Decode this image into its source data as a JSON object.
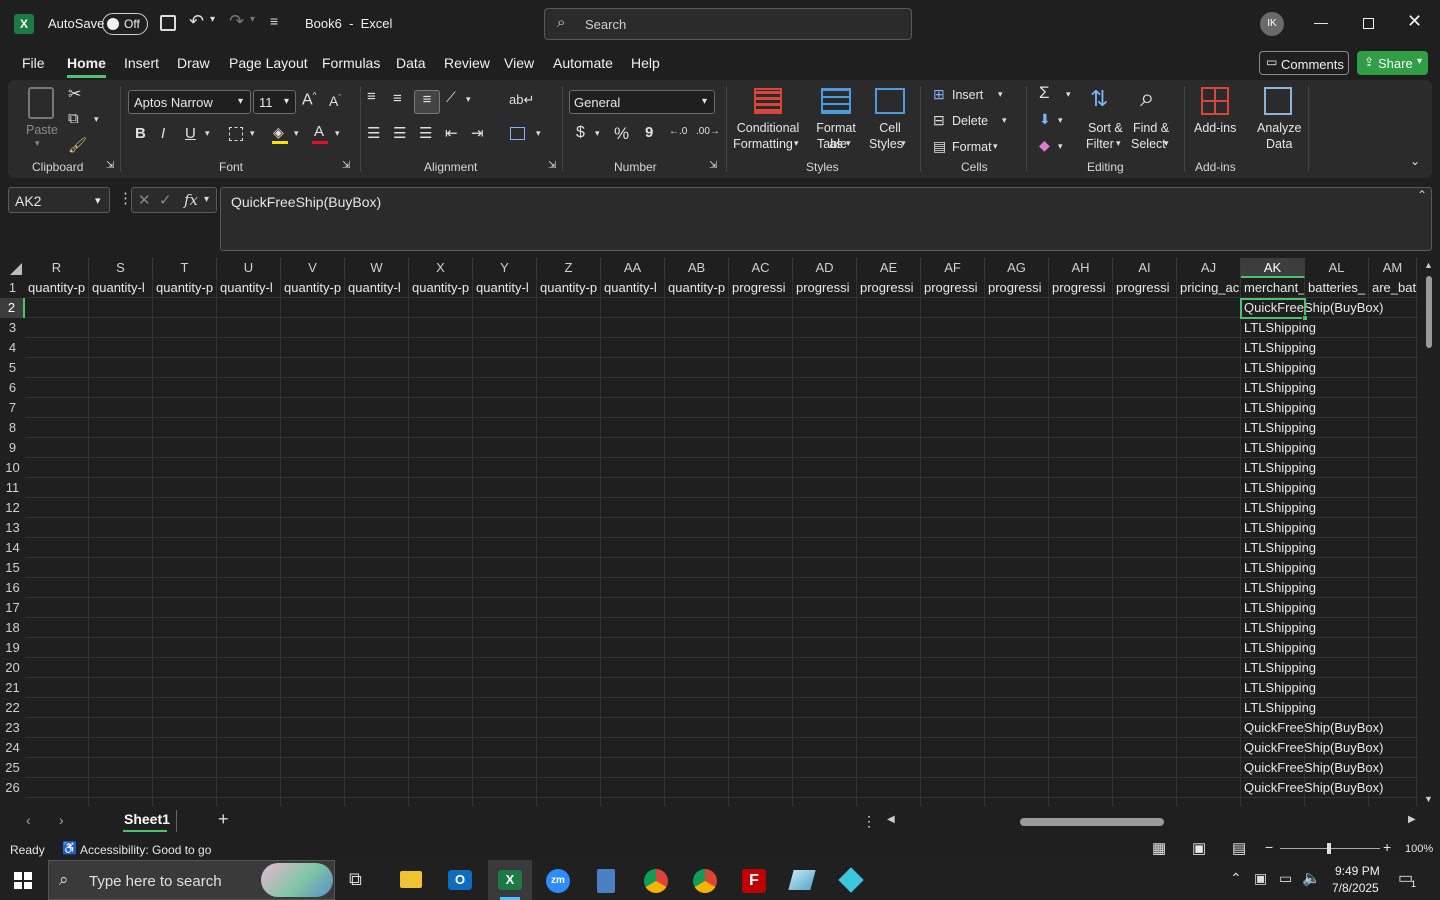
{
  "titlebar": {
    "autosave_label": "AutoSave",
    "autosave_state": "Off",
    "document_title": "Book6  -  Excel",
    "search_placeholder": "Search",
    "avatar_initials": "IK"
  },
  "menu": {
    "items": [
      "File",
      "Home",
      "Insert",
      "Draw",
      "Page Layout",
      "Formulas",
      "Data",
      "Review",
      "View",
      "Automate",
      "Help"
    ],
    "active": "Home",
    "comments_label": "Comments",
    "share_label": "Share"
  },
  "ribbon": {
    "clipboard": {
      "paste_label": "Paste",
      "group_label": "Clipboard"
    },
    "font": {
      "font_name": "Aptos Narrow",
      "font_size": "11",
      "bold": "B",
      "italic": "I",
      "underline": "U",
      "group_label": "Font"
    },
    "alignment": {
      "group_label": "Alignment"
    },
    "number": {
      "format": "General",
      "currency": "$",
      "percent": "%",
      "comma": "9",
      "group_label": "Number"
    },
    "styles": {
      "conditional_line1": "Conditional",
      "conditional_line2": "Formatting",
      "format_table_line1": "Format as",
      "format_table_line2": "Table",
      "cell_styles_line1": "Cell",
      "cell_styles_line2": "Styles",
      "group_label": "Styles"
    },
    "cells": {
      "insert_label": "Insert",
      "delete_label": "Delete",
      "format_label": "Format",
      "group_label": "Cells"
    },
    "editing": {
      "sort_line1": "Sort &",
      "sort_line2": "Filter",
      "find_line1": "Find &",
      "find_line2": "Select",
      "group_label": "Editing"
    },
    "addins": {
      "addins_label": "Add-ins",
      "analyze_line1": "Analyze",
      "analyze_line2": "Data",
      "group_label": "Add-ins"
    }
  },
  "formula_bar": {
    "name_box": "AK2",
    "fx": "fx",
    "content": "QuickFreeShip(BuyBox)"
  },
  "grid": {
    "columns": [
      "R",
      "S",
      "T",
      "U",
      "V",
      "W",
      "X",
      "Y",
      "Z",
      "AA",
      "AB",
      "AC",
      "AD",
      "AE",
      "AF",
      "AG",
      "AH",
      "AI",
      "AJ",
      "AK",
      "AL",
      "AM"
    ],
    "selected_column": "AK",
    "rows": [
      "1",
      "2",
      "3",
      "4",
      "5",
      "6",
      "7",
      "8",
      "9",
      "10",
      "11",
      "12",
      "13",
      "14",
      "15",
      "16",
      "17",
      "18",
      "19",
      "20",
      "21",
      "22",
      "23",
      "24",
      "25",
      "26"
    ],
    "selected_row": "2",
    "header_row": [
      "quantity-p",
      "quantity-l",
      "quantity-p",
      "quantity-l",
      "quantity-p",
      "quantity-l",
      "quantity-p",
      "quantity-l",
      "quantity-p",
      "quantity-l",
      "quantity-p",
      "progressi",
      "progressi",
      "progressi",
      "progressi",
      "progressi",
      "progressi",
      "progressi",
      "pricing_ac",
      "merchant_",
      "batteries_",
      "are_bat"
    ],
    "ak_values": [
      "QuickFreeShip(BuyBox)",
      "LTLShipping",
      "LTLShipping",
      "LTLShipping",
      "LTLShipping",
      "LTLShipping",
      "LTLShipping",
      "LTLShipping",
      "LTLShipping",
      "LTLShipping",
      "LTLShipping",
      "LTLShipping",
      "LTLShipping",
      "LTLShipping",
      "LTLShipping",
      "LTLShipping",
      "LTLShipping",
      "LTLShipping",
      "LTLShipping",
      "LTLShipping",
      "LTLShipping",
      "QuickFreeShip(BuyBox)",
      "QuickFreeShip(BuyBox)",
      "QuickFreeShip(BuyBox)",
      "QuickFreeShip(BuyBox)"
    ]
  },
  "sheets": {
    "tabs": [
      "Sheet1"
    ],
    "active": "Sheet1"
  },
  "status": {
    "ready": "Ready",
    "accessibility": "Accessibility: Good to go",
    "zoom": "100%"
  },
  "taskbar": {
    "search_placeholder": "Type here to search",
    "time": "9:49 PM",
    "date": "7/8/2025",
    "notification_count": "1"
  },
  "colors": {
    "accent_green": "#4fc36a",
    "share_green": "#2f9e44",
    "excel_green": "#1d7a45"
  }
}
